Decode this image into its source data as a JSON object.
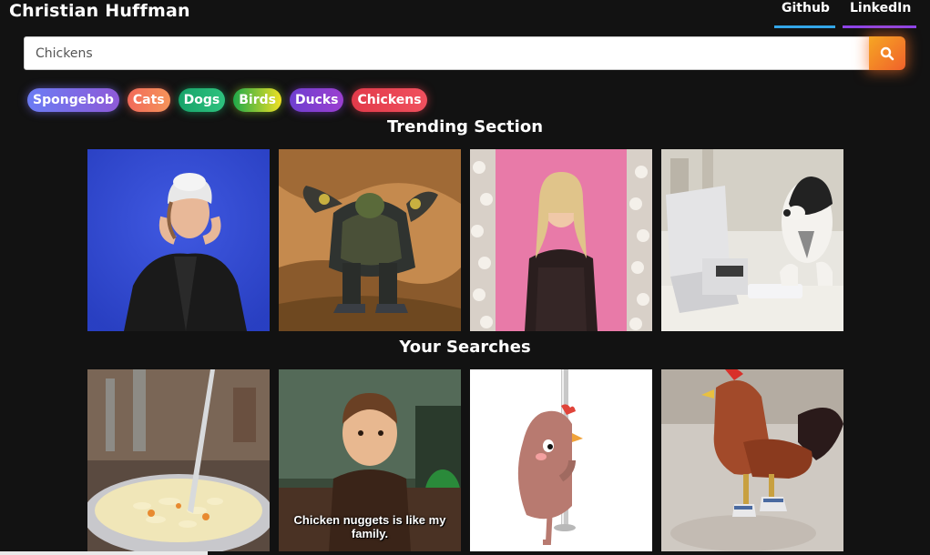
{
  "header": {
    "brand": "Christian Huffman",
    "nav": [
      {
        "label": "Github",
        "underline_color": "#33a6e8"
      },
      {
        "label": "LinkedIn",
        "underline_color": "#8e44e8"
      }
    ]
  },
  "search": {
    "value": "Chickens",
    "button_icon": "search-icon",
    "button_color": "#f47b28"
  },
  "tags": [
    {
      "label": "Spongebob"
    },
    {
      "label": "Cats"
    },
    {
      "label": "Dogs"
    },
    {
      "label": "Birds"
    },
    {
      "label": "Ducks"
    },
    {
      "label": "Chickens"
    }
  ],
  "trending": {
    "title": "Trending Section",
    "items": [
      {
        "subject": "woman-in-white-cap-gif"
      },
      {
        "subject": "armored-orc-gif"
      },
      {
        "subject": "woman-pink-backdrop-gif"
      },
      {
        "subject": "dog-at-computer-gif"
      }
    ]
  },
  "searches": {
    "title": "Your Searches",
    "items": [
      {
        "subject": "chicken-noodle-soup-gif"
      },
      {
        "subject": "boy-on-couch-gif",
        "caption": "Chicken nuggets is like my family."
      },
      {
        "subject": "cartoon-chicken-pole-gif"
      },
      {
        "subject": "rooster-in-sneakers-gif"
      }
    ]
  }
}
